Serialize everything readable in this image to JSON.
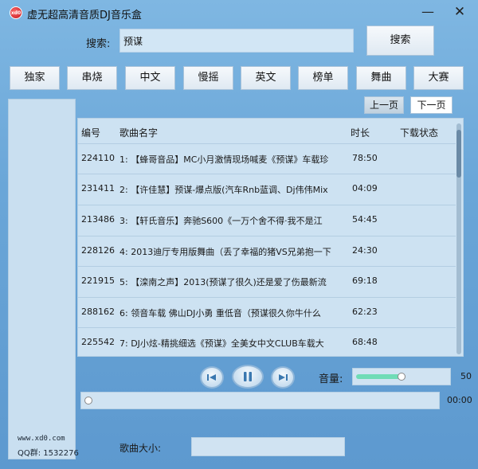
{
  "window": {
    "logo_text": "xd0",
    "title": "虚无超高清音质DJ音乐盒",
    "min_glyph": "—",
    "close_glyph": "✕"
  },
  "search": {
    "label": "搜索:",
    "value": "预谋",
    "button": "搜索"
  },
  "categories": [
    "独家",
    "串烧",
    "中文",
    "慢摇",
    "英文",
    "榜单",
    "舞曲",
    "大赛"
  ],
  "paging": {
    "prev": "上一页",
    "next": "下一页"
  },
  "table": {
    "headers": {
      "id": "编号",
      "name": "歌曲名字",
      "duration": "时长",
      "status": "下载状态"
    },
    "rows": [
      {
        "id": "224110",
        "name": "1: 【蜂哥音品】MC小月激情现场喊麦《预谋》车载珍",
        "duration": "78:50"
      },
      {
        "id": "231411",
        "name": "2: 【许佳慧】预谋-爆点版(汽车Rnb蓝调、Dj伟伟Mix",
        "duration": "04:09"
      },
      {
        "id": "213486",
        "name": "3: 【轩氏音乐】奔驰S600《一万个舍不得·我不是江",
        "duration": "54:45"
      },
      {
        "id": "228126",
        "name": "4: 2013迪厅专用版舞曲（丢了幸福的猪VS兄弟抱一下",
        "duration": "24:30"
      },
      {
        "id": "221915",
        "name": "5: 【滦南之声】2013(预谋了很久)还是爱了伤最新流",
        "duration": "69:18"
      },
      {
        "id": "288162",
        "name": "6: 领音车载 佛山DJ小勇 重低音（预谋很久你牛什么",
        "duration": "62:23"
      },
      {
        "id": "225542",
        "name": "7: DJ小炫-精挑细选《预谋》全美女中文CLUB车载大",
        "duration": "68:48"
      }
    ]
  },
  "player": {
    "prev_icon": "skip-previous-icon",
    "play_icon": "pause-icon",
    "next_icon": "skip-next-icon",
    "volume_label": "音量:",
    "volume": "50",
    "volume_fraction": 0.5,
    "time": "00:00",
    "progress_fraction": 0
  },
  "footer": {
    "url": "www.xd0.com",
    "qq": "QQ群: 1532276",
    "size_label": "歌曲大小:"
  },
  "colors": {
    "background": "#6aa6d8",
    "panel": "#cde2f2",
    "volume_fill": "#6fdcb6"
  }
}
